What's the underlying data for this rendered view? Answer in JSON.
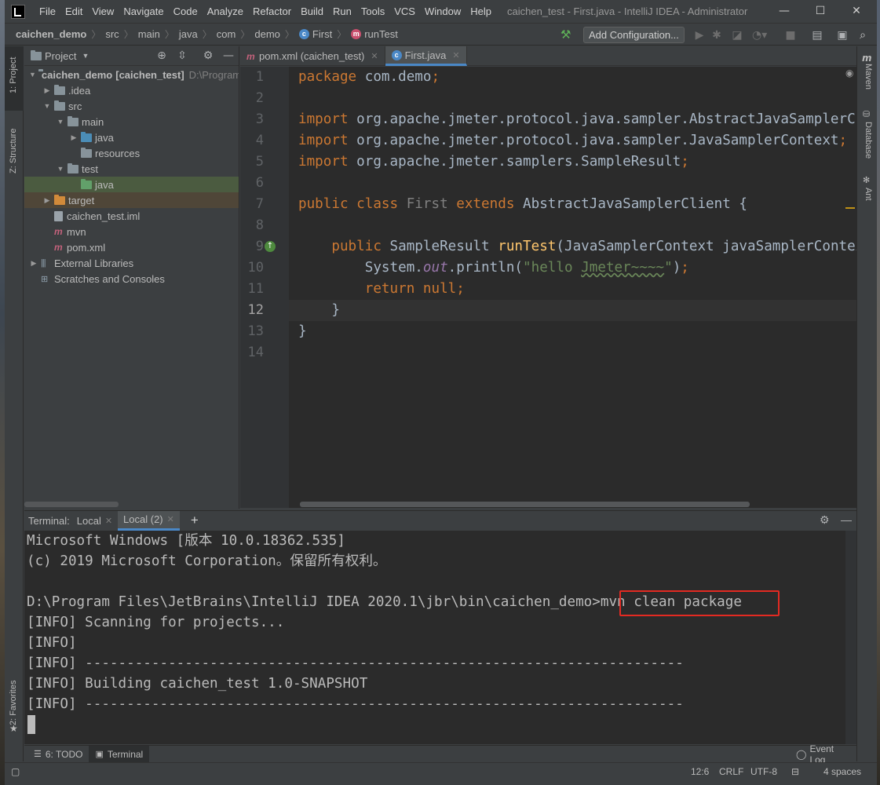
{
  "window": {
    "title": "caichen_test - First.java - IntelliJ IDEA - Administrator",
    "minimize": "—",
    "maximize": "☐",
    "close": "✕"
  },
  "menu": [
    "File",
    "Edit",
    "View",
    "Navigate",
    "Code",
    "Analyze",
    "Refactor",
    "Build",
    "Run",
    "Tools",
    "VCS",
    "Window",
    "Help"
  ],
  "breadcrumbs": [
    "caichen_demo",
    "src",
    "main",
    "java",
    "com",
    "demo",
    "First",
    "runTest"
  ],
  "toolbar": {
    "add_configuration": "Add Configuration..."
  },
  "left_strip": {
    "project": "1: Project",
    "structure": "Z: Structure",
    "favorites": "2: Favorites"
  },
  "right_strip": {
    "maven": "Maven",
    "database": "Database",
    "ant": "Ant"
  },
  "project_panel": {
    "title": "Project",
    "tree": [
      {
        "label": "caichen_demo",
        "suffix": "[caichen_test]",
        "path": "D:\\Program",
        "depth": 0,
        "expanded": true,
        "icon": "folder-module"
      },
      {
        "label": ".idea",
        "depth": 1,
        "expanded": false,
        "icon": "folder"
      },
      {
        "label": "src",
        "depth": 1,
        "expanded": true,
        "icon": "folder"
      },
      {
        "label": "main",
        "depth": 2,
        "expanded": true,
        "icon": "folder"
      },
      {
        "label": "java",
        "depth": 3,
        "expanded": false,
        "icon": "folder-source"
      },
      {
        "label": "resources",
        "depth": 3,
        "icon": "folder-resources"
      },
      {
        "label": "test",
        "depth": 2,
        "expanded": true,
        "icon": "folder"
      },
      {
        "label": "java",
        "depth": 3,
        "icon": "folder-test",
        "selected": true
      },
      {
        "label": "target",
        "depth": 1,
        "expanded": false,
        "icon": "folder-excluded",
        "highlight": true
      },
      {
        "label": "caichen_test.iml",
        "depth": 1,
        "icon": "iml-file"
      },
      {
        "label": "mvn",
        "depth": 1,
        "icon": "mvn-file"
      },
      {
        "label": "pom.xml",
        "depth": 1,
        "icon": "maven-file"
      },
      {
        "label": "External Libraries",
        "depth": 0,
        "expanded": false,
        "icon": "libraries"
      },
      {
        "label": "Scratches and Consoles",
        "depth": 0,
        "icon": "scratches"
      }
    ]
  },
  "editor": {
    "tabs": [
      {
        "label": "pom.xml (caichen_test)",
        "icon": "maven-file",
        "active": false
      },
      {
        "label": "First.java",
        "icon": "class-file",
        "active": true
      }
    ],
    "current_line": 12,
    "lines": [
      {
        "n": "1",
        "tokens": [
          [
            "kw",
            "package "
          ],
          [
            "cls",
            "com.demo"
          ],
          [
            "kw",
            ";"
          ]
        ]
      },
      {
        "n": "2",
        "tokens": []
      },
      {
        "n": "3",
        "tokens": [
          [
            "kw",
            "import "
          ],
          [
            "cls",
            "org.apache.jmeter.protocol.java.sampler.AbstractJavaSamplerClient"
          ],
          [
            "kw",
            ";"
          ]
        ]
      },
      {
        "n": "4",
        "tokens": [
          [
            "kw",
            "import "
          ],
          [
            "cls",
            "org.apache.jmeter.protocol.java.sampler.JavaSamplerContext"
          ],
          [
            "kw",
            ";"
          ]
        ]
      },
      {
        "n": "5",
        "tokens": [
          [
            "kw",
            "import "
          ],
          [
            "cls",
            "org.apache.jmeter.samplers.SampleResult"
          ],
          [
            "kw",
            ";"
          ]
        ]
      },
      {
        "n": "6",
        "tokens": []
      },
      {
        "n": "7",
        "tokens": [
          [
            "kw",
            "public class "
          ],
          [
            "gray",
            "First "
          ],
          [
            "kw",
            "extends "
          ],
          [
            "cls",
            "AbstractJavaSamplerClient {"
          ]
        ]
      },
      {
        "n": "8",
        "tokens": []
      },
      {
        "n": "9",
        "tokens": [
          [
            "cls",
            "    "
          ],
          [
            "kw",
            "public "
          ],
          [
            "cls",
            "SampleResult "
          ],
          [
            "fn",
            "runTest"
          ],
          [
            "cls",
            "(JavaSamplerContext javaSamplerContext) {"
          ]
        ]
      },
      {
        "n": "10",
        "tokens": [
          [
            "cls",
            "        System."
          ],
          [
            "ital",
            "out"
          ],
          [
            "cls",
            ".println("
          ],
          [
            "str",
            "\"hello "
          ],
          [
            "wavy",
            "Jmeter~~~~"
          ],
          [
            "str",
            "\""
          ],
          [
            "cls",
            ")"
          ],
          [
            "kw",
            ";"
          ]
        ]
      },
      {
        "n": "11",
        "tokens": [
          [
            "cls",
            "        "
          ],
          [
            "kw",
            "return null;"
          ]
        ]
      },
      {
        "n": "12",
        "tokens": [
          [
            "cls",
            "    }"
          ]
        ]
      },
      {
        "n": "13",
        "tokens": [
          [
            "cls",
            "}"
          ]
        ]
      },
      {
        "n": "14",
        "tokens": []
      }
    ]
  },
  "terminal": {
    "label": "Terminal:",
    "tabs": [
      {
        "label": "Local",
        "active": false
      },
      {
        "label": "Local (2)",
        "active": true
      }
    ],
    "prompt": "D:\\Program Files\\JetBrains\\IntelliJ IDEA 2020.1\\jbr\\bin\\caichen_demo>",
    "command": "mvn clean package",
    "output": [
      "Microsoft Windows [版本 10.0.18362.535]",
      "(c) 2019 Microsoft Corporation。保留所有权利。",
      "",
      "",
      "[INFO] Scanning for projects...",
      "[INFO]",
      "[INFO] ------------------------------------------------------------------------",
      "[INFO] Building caichen_test 1.0-SNAPSHOT",
      "[INFO] ------------------------------------------------------------------------"
    ]
  },
  "bottom_tools": [
    {
      "label": "6: TODO",
      "icon": "todo-icon",
      "active": false
    },
    {
      "label": "Terminal",
      "icon": "terminal-icon",
      "active": true
    }
  ],
  "event_log": "Event Log",
  "status": {
    "position": "12:6",
    "line_sep": "CRLF",
    "encoding": "UTF-8",
    "indent": "4 spaces"
  },
  "colors": {
    "accent": "#4a88c7",
    "highlight_box": "#e32a22",
    "keyword": "#cc7832",
    "string": "#6a8759",
    "method": "#ffc66d"
  }
}
